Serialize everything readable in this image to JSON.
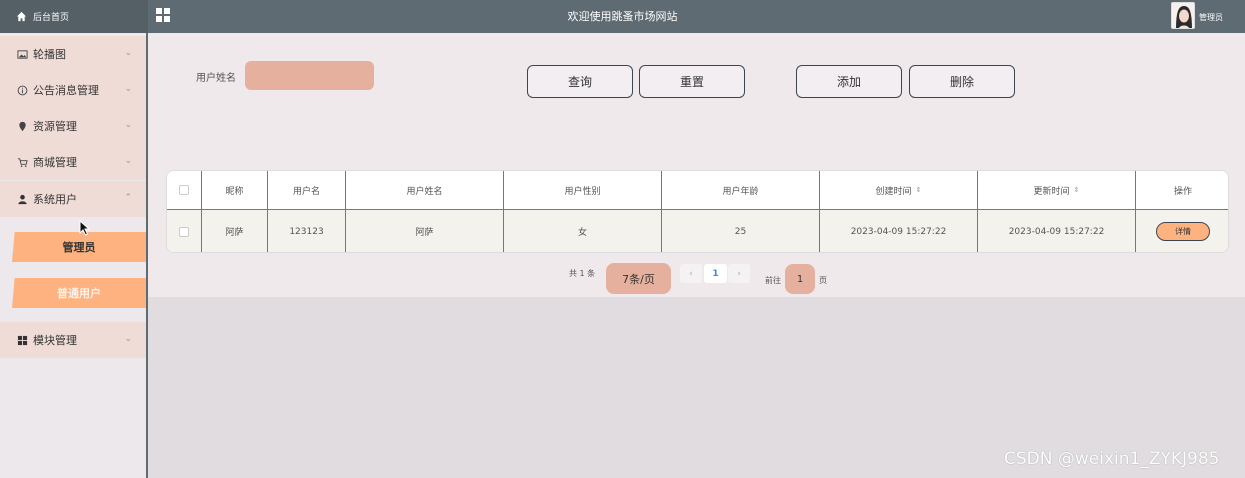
{
  "topbar": {
    "home_label": "后台首页",
    "title": "欢迎使用跳蚤市场网站",
    "user": "管理员"
  },
  "sidebar": {
    "items": [
      {
        "label": "轮播图",
        "icon": "image-icon"
      },
      {
        "label": "公告消息管理",
        "icon": "info-icon"
      },
      {
        "label": "资源管理",
        "icon": "location-icon"
      },
      {
        "label": "商城管理",
        "icon": "cart-icon"
      },
      {
        "label": "系统用户",
        "icon": "user-icon"
      },
      {
        "label": "模块管理",
        "icon": "grid-icon"
      }
    ],
    "sub_items": [
      "管理员",
      "普通用户"
    ]
  },
  "search": {
    "label": "用户姓名",
    "value": ""
  },
  "buttons": {
    "query": "查询",
    "reset": "重置",
    "add": "添加",
    "delete": "删除"
  },
  "table": {
    "headers": [
      "昵称",
      "用户名",
      "用户姓名",
      "用户性别",
      "用户年龄",
      "创建时间",
      "更新时间",
      "操作"
    ],
    "rows": [
      {
        "nickname": "阿萨",
        "username": "123123",
        "realname": "阿萨",
        "gender": "女",
        "age": "25",
        "created": "2023-04-09 15:27:22",
        "updated": "2023-04-09 15:27:22",
        "action": "详情"
      }
    ]
  },
  "pagination": {
    "total": "共 1 条",
    "page_size": "7条/页",
    "prev": "‹",
    "current": "1",
    "next": "›",
    "goto_label": "前往",
    "goto_value": "1",
    "page_suffix": "页"
  },
  "watermark": "CSDN @weixin1_ZYKJ985",
  "colors": {
    "topbar": "#5f6b73",
    "accent": "#fdb27f",
    "input_fill": "#e6b09e",
    "panel": "#f0e9ec"
  }
}
